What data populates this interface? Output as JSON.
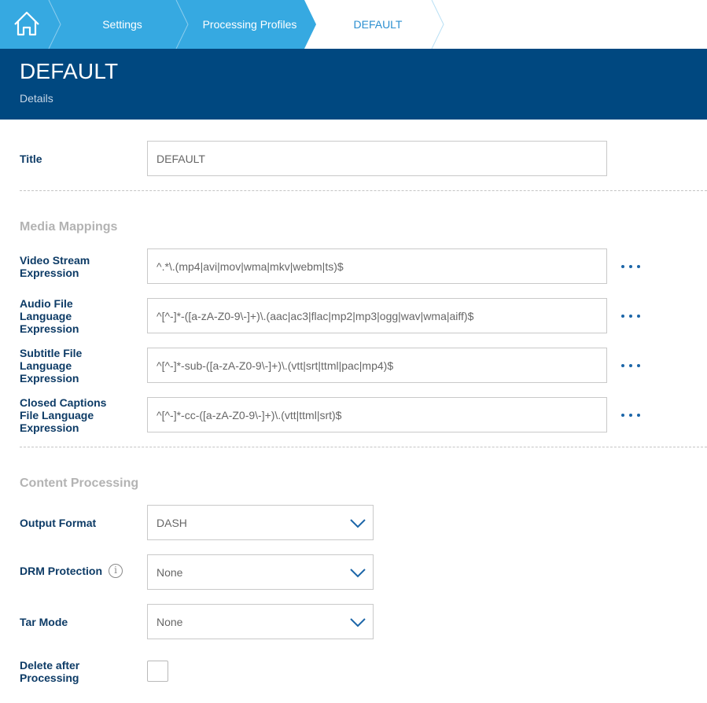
{
  "breadcrumb": {
    "items": [
      {
        "label": "Settings"
      },
      {
        "label": "Processing Profiles"
      },
      {
        "label": "DEFAULT"
      }
    ]
  },
  "header": {
    "title": "DEFAULT",
    "subtitle": "Details"
  },
  "form": {
    "title_label": "Title",
    "title_value": "DEFAULT",
    "media_mappings": {
      "heading": "Media Mappings",
      "video_label": "Video Stream Expression",
      "video_value": "^.*\\.(mp4|avi|mov|wma|mkv|webm|ts)$",
      "audio_label": "Audio File Language Expression",
      "audio_value": "^[^-]*-([a-zA-Z0-9\\-]+)\\.(aac|ac3|flac|mp2|mp3|ogg|wav|wma|aiff)$",
      "subtitle_label": "Subtitle File Language Expression",
      "subtitle_value": "^[^-]*-sub-([a-zA-Z0-9\\-]+)\\.(vtt|srt|ttml|pac|mp4)$",
      "cc_label": "Closed Captions File Language Expression",
      "cc_value": "^[^-]*-cc-([a-zA-Z0-9\\-]+)\\.(vtt|ttml|srt)$"
    },
    "content_processing": {
      "heading": "Content Processing",
      "output_format_label": "Output Format",
      "output_format_value": "DASH",
      "drm_label": "DRM Protection",
      "drm_value": "None",
      "tar_label": "Tar Mode",
      "tar_value": "None",
      "delete_label": "Delete after Processing",
      "delete_checked": false
    }
  },
  "colors": {
    "breadcrumb_active": "#36a9e1",
    "header_bg": "#004880",
    "label": "#0d3b66",
    "section": "#b3b3b3",
    "accent": "#1c66a8"
  },
  "icons": [
    "home-icon",
    "chevron-down-icon",
    "more-icon",
    "info-icon"
  ]
}
